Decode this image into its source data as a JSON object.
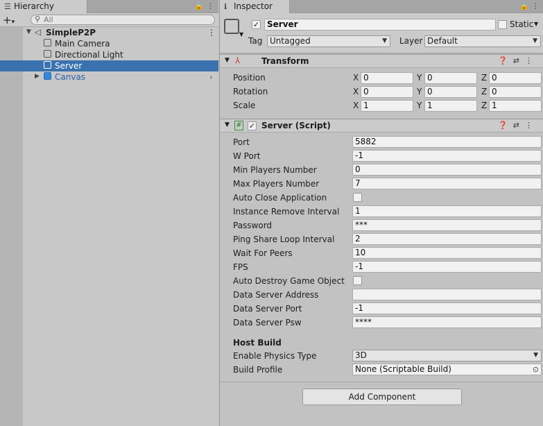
{
  "hierarchy": {
    "tab_label": "Hierarchy",
    "search_placeholder": "All",
    "scene": "SimpleP2P",
    "items": [
      {
        "label": "Main Camera"
      },
      {
        "label": "Directional Light"
      },
      {
        "label": "Server"
      },
      {
        "label": "Canvas"
      }
    ]
  },
  "inspector": {
    "tab_label": "Inspector",
    "object_name": "Server",
    "static_label": "Static",
    "tag_label": "Tag",
    "tag_value": "Untagged",
    "layer_label": "Layer",
    "layer_value": "Default",
    "transform": {
      "title": "Transform",
      "rows": [
        {
          "label": "Position",
          "x": "0",
          "y": "0",
          "z": "0"
        },
        {
          "label": "Rotation",
          "x": "0",
          "y": "0",
          "z": "0"
        },
        {
          "label": "Scale",
          "x": "1",
          "y": "1",
          "z": "1"
        }
      ],
      "axis_x": "X",
      "axis_y": "Y",
      "axis_z": "Z"
    },
    "script": {
      "title": "Server (Script)",
      "fields": [
        {
          "label": "Port",
          "value": "5882"
        },
        {
          "label": "W Port",
          "value": "-1"
        },
        {
          "label": "Min Players Number",
          "value": "0"
        },
        {
          "label": "Max Players Number",
          "value": "7"
        },
        {
          "label": "Auto Close Application",
          "value": ""
        },
        {
          "label": "Instance Remove Interval",
          "value": "1"
        },
        {
          "label": "Password",
          "value": "***"
        },
        {
          "label": "Ping Share Loop Interval",
          "value": "2"
        },
        {
          "label": "Wait For Peers",
          "value": "10"
        },
        {
          "label": "FPS",
          "value": "-1"
        },
        {
          "label": "Auto Destroy Game Object",
          "value": ""
        },
        {
          "label": "Data Server Address",
          "value": ""
        },
        {
          "label": "Data Server Port",
          "value": "-1"
        },
        {
          "label": "Data Server Psw",
          "value": "****"
        }
      ],
      "host_build_title": "Host Build",
      "physics_label": "Enable Physics Type",
      "physics_value": "3D",
      "profile_label": "Build Profile",
      "profile_value": "None (Scriptable Build)"
    },
    "add_component": "Add Component"
  }
}
